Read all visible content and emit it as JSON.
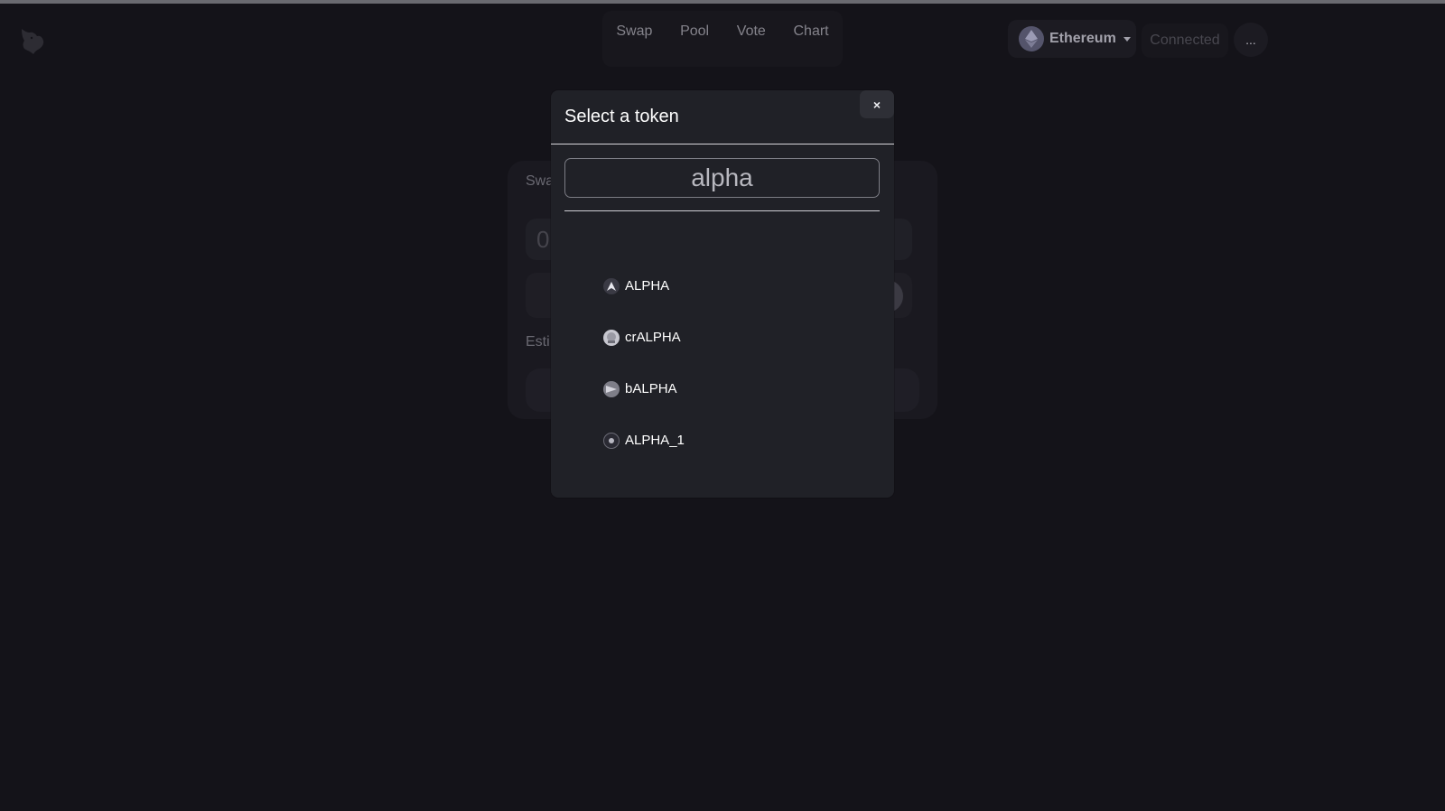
{
  "header": {
    "nav": [
      "Swap",
      "Pool",
      "Vote",
      "Chart"
    ],
    "network": {
      "label": "Ethereum",
      "icon": "ethereum-icon"
    },
    "connected_label": "Connected",
    "more_label": "..."
  },
  "swap_card": {
    "title": "Swa",
    "input_value": "0",
    "estimate_label": "Esti"
  },
  "modal": {
    "title": "Select a token",
    "close_label": "×",
    "search_value": "alpha",
    "tokens": [
      {
        "label": "ALPHA",
        "icon": "alpha-token-icon"
      },
      {
        "label": "crALPHA",
        "icon": "cralpha-token-icon"
      },
      {
        "label": "bALPHA",
        "icon": "balpha-token-icon"
      },
      {
        "label": "ALPHA_1",
        "icon": "alpha1-token-icon"
      }
    ]
  },
  "colors": {
    "background": "#141319",
    "modal_bg": "#202127",
    "text_primary": "#ffffff",
    "text_muted": "#84838b"
  }
}
